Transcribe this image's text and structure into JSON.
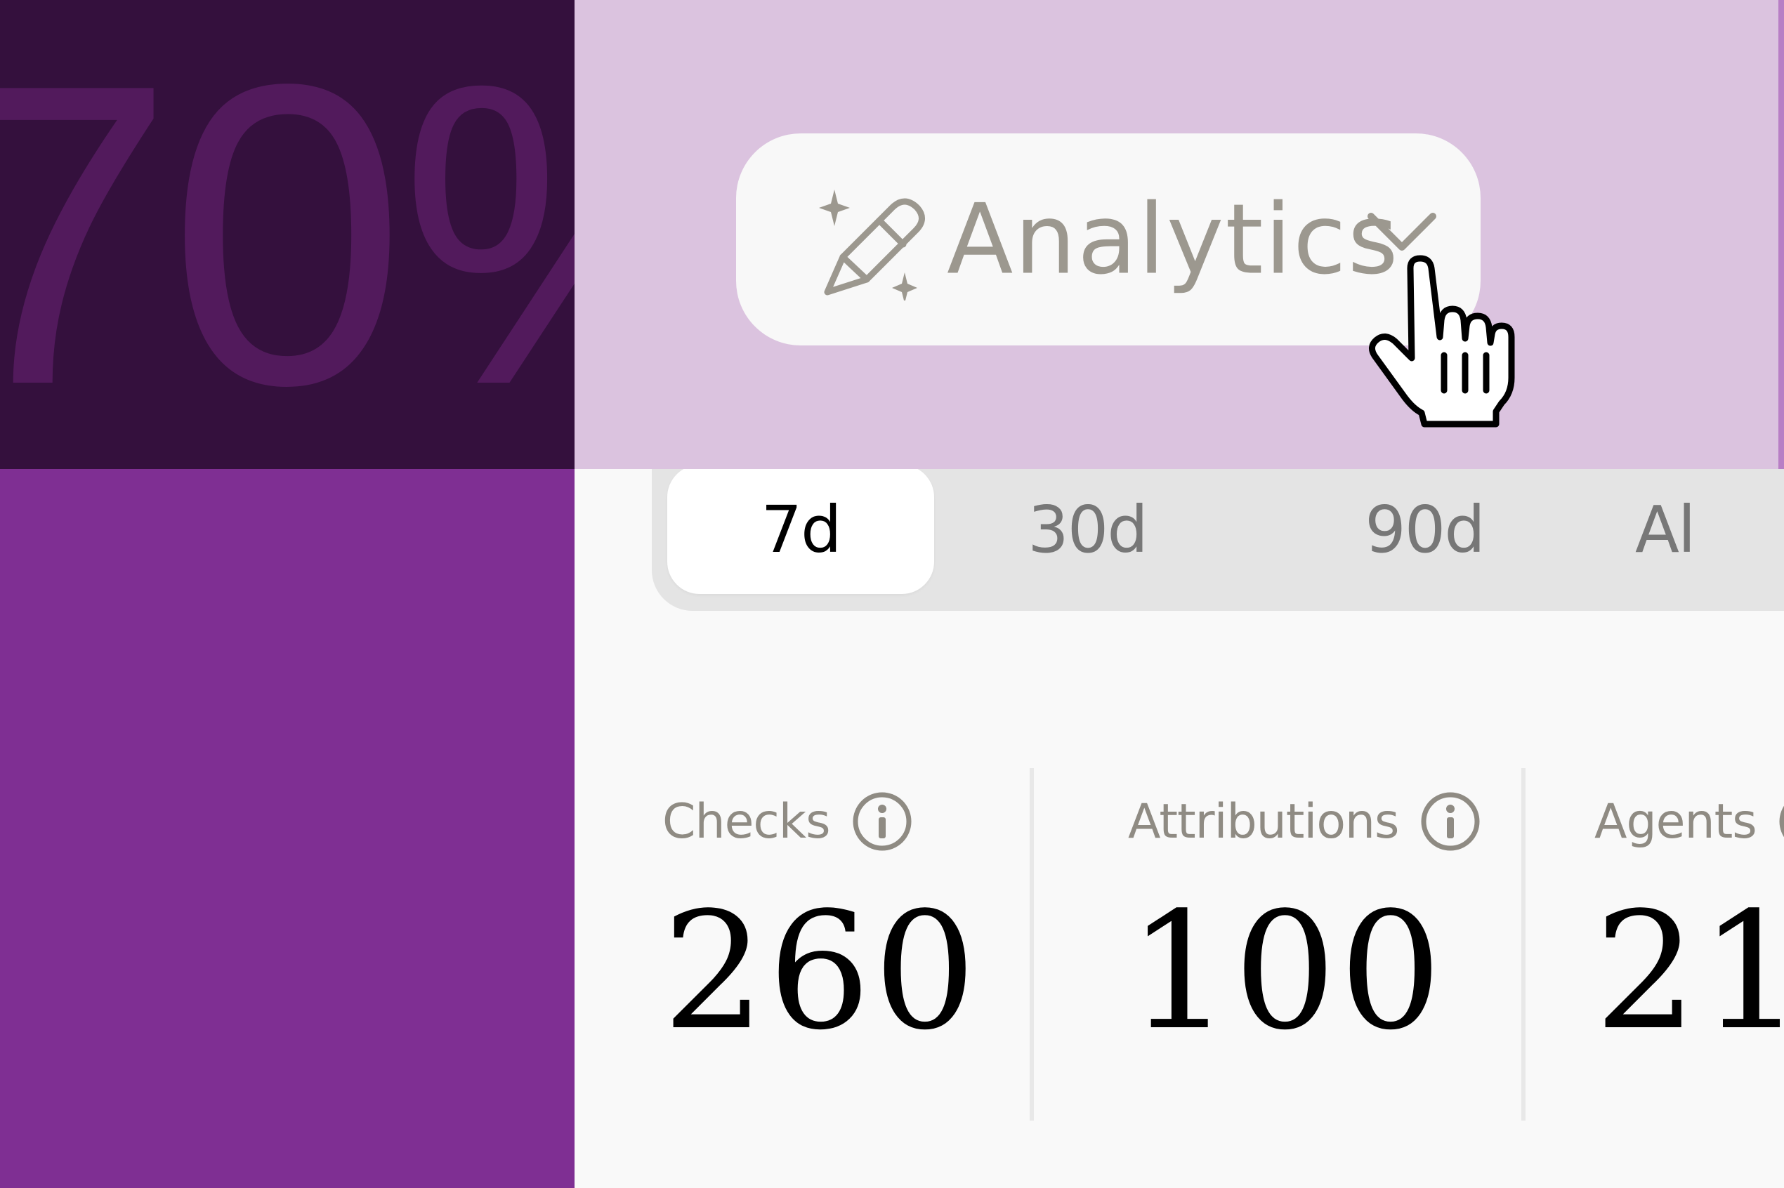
{
  "hero": {
    "big_text": "70%"
  },
  "dropdown": {
    "label": "Analytics",
    "icon": "sparkle-pen-icon",
    "chevron_icon": "chevron-down-icon"
  },
  "period_tabs": [
    {
      "label": "7d",
      "active": true
    },
    {
      "label": "30d",
      "active": false
    },
    {
      "label": "90d",
      "active": false
    },
    {
      "label": "Al",
      "active": false
    }
  ],
  "stats": [
    {
      "label": "Checks",
      "value": "260",
      "icon": "info-icon"
    },
    {
      "label": "Attributions",
      "value": "100",
      "icon": "info-icon"
    },
    {
      "label": "Agents",
      "value": "21",
      "icon": "info-icon"
    }
  ],
  "colors": {
    "left_dark": "#34103d",
    "left_text": "#521a5c",
    "left_purple": "#7f2f93",
    "highlight_band": "#dbc3df",
    "muted_text": "#8f8b83",
    "panel_bg": "#f9f9f9"
  }
}
